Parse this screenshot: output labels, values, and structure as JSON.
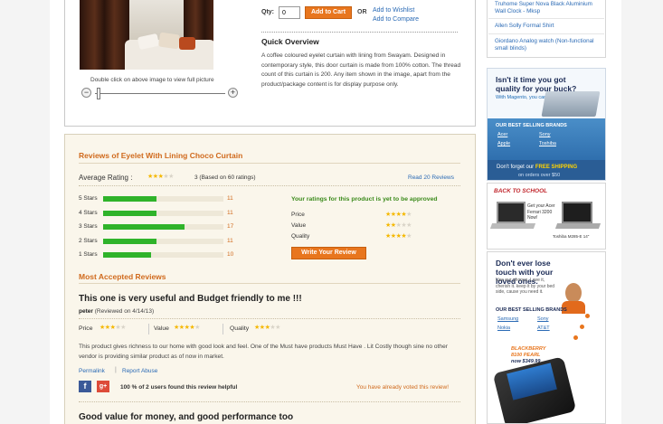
{
  "product": {
    "dblclick_hint": "Double click on above image to view full picture",
    "zoom_minus": "−",
    "zoom_plus": "+",
    "qty_label": "Qty:",
    "qty_value": "0",
    "add_to_cart": "Add to Cart",
    "or": "OR",
    "add_wishlist": "Add to Wishlist",
    "add_compare": "Add to Compare",
    "quick_overview_title": "Quick Overview",
    "quick_overview_text": "A coffee coloured eyelet curtain with lining from Swayam. Designed in contemporary style, this door curtain is made from 100% cotton. The thread count of this curtain is 200. Any item shown in the image, apart from the product/package content is for display purpose only."
  },
  "reviews": {
    "title": "Reviews of Eyelet With Lining Choco Curtain",
    "average_label": "Average Rating :",
    "average_stars": 3,
    "average_text": "3 (Based on 60 ratings)",
    "read_link": "Read 20 Reviews",
    "breakdown": [
      {
        "label": "5 Stars",
        "count": "11",
        "value": 11
      },
      {
        "label": "4 Stars",
        "count": "11",
        "value": 11
      },
      {
        "label": "3 Stars",
        "count": "17",
        "value": 17
      },
      {
        "label": "2 Stars",
        "count": "11",
        "value": 11
      },
      {
        "label": "1 Stars",
        "count": "10",
        "value": 10
      }
    ],
    "breakdown_max": 60,
    "your_ratings_notice": "Your ratings for this product is yet to be approved",
    "your_ratings": [
      {
        "label": "Price",
        "stars": 4
      },
      {
        "label": "Value",
        "stars": 2
      },
      {
        "label": "Quality",
        "stars": 4
      }
    ],
    "write_review": "Write Your Review",
    "most_accepted_title": "Most Accepted Reviews",
    "review1": {
      "headline": "This one is very useful and Budget friendly to me !!!",
      "author": "peter",
      "reviewed_on": "(Reviewed on 4/14/13)",
      "price_label": "Price",
      "price_stars": 3,
      "value_label": "Value",
      "value_stars": 4,
      "quality_label": "Quality",
      "quality_stars": 3,
      "text": "This product gives richness to our home with good look and feel. One of the Must have products Must Have . Lit Costly though sine no other vendor is providing similar product as of now in market.",
      "permalink": "Permalink",
      "pipe": "|",
      "report": "Report Abuse",
      "fb": "f",
      "gplus": "g+",
      "helpful": "100 % of 2 users found this review helpful",
      "voted": "You have already voted this review!"
    },
    "review2": {
      "headline": "Good value for money, and good performance too"
    }
  },
  "sidebar": {
    "links": [
      "Truhome Super Nova Black Aluminium Wall Clock - Mksp",
      "Allen Solly Formal Shirt",
      "Giordano Analog watch (Non-functional small blinds)"
    ],
    "ad1": {
      "headline": "Isn't it time you got quality for your buck?",
      "sub": "With Magento, you can.",
      "brands_title": "OUR BEST SELLING BRANDS",
      "brands": [
        "Acer",
        "Sony",
        "Apple",
        "Toshiba"
      ],
      "shipping_prefix": "Don't forget our ",
      "shipping_bold": "FREE SHIPPING",
      "shipping_sub": "on orders over $50"
    },
    "ad2": {
      "title": "BACK TO SCHOOL",
      "promo": "Get your Acer Ferrari 3200 Now!",
      "caption": "Toshiba M285-E 14\""
    },
    "ad3": {
      "headline": "Don't ever lose touch with your loved ones.",
      "sub": "Use our phones. Love it, cherish it. keep it by your bed side, cause you need it.",
      "brands_title": "OUR BEST SELLING BRANDS",
      "brands": [
        "Samsung",
        "Sony",
        "Nokia",
        "AT&T"
      ],
      "promo_line1": "BLACKBERRY",
      "promo_line2": "8100 PEARL",
      "promo_price": "now $349.99"
    }
  },
  "colors": {
    "accent_orange": "#e8761e",
    "link_blue": "#2a6ab5",
    "bar_green": "#2fb32a",
    "star_gold": "#f5b800"
  }
}
